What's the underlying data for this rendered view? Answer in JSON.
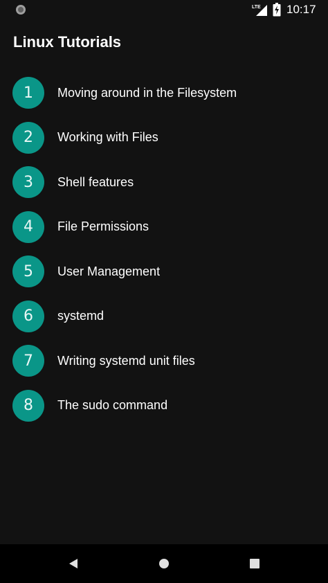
{
  "status_bar": {
    "time": "10:17",
    "network_badge": "LTE",
    "icons": [
      "notification-dot-icon",
      "lte-signal-icon",
      "battery-charging-icon"
    ]
  },
  "app": {
    "title": "Linux Tutorials",
    "accent_color": "#0a9688",
    "background_color": "#121212"
  },
  "tutorials": [
    {
      "number": "1",
      "label": "Moving around in the Filesystem"
    },
    {
      "number": "2",
      "label": "Working with Files"
    },
    {
      "number": "3",
      "label": "Shell features"
    },
    {
      "number": "4",
      "label": "File Permissions"
    },
    {
      "number": "5",
      "label": "User Management"
    },
    {
      "number": "6",
      "label": "systemd"
    },
    {
      "number": "7",
      "label": "Writing systemd unit files"
    },
    {
      "number": "8",
      "label": "The sudo command"
    }
  ],
  "nav_bar": {
    "icons": [
      "back-icon",
      "home-icon",
      "recents-icon"
    ]
  }
}
